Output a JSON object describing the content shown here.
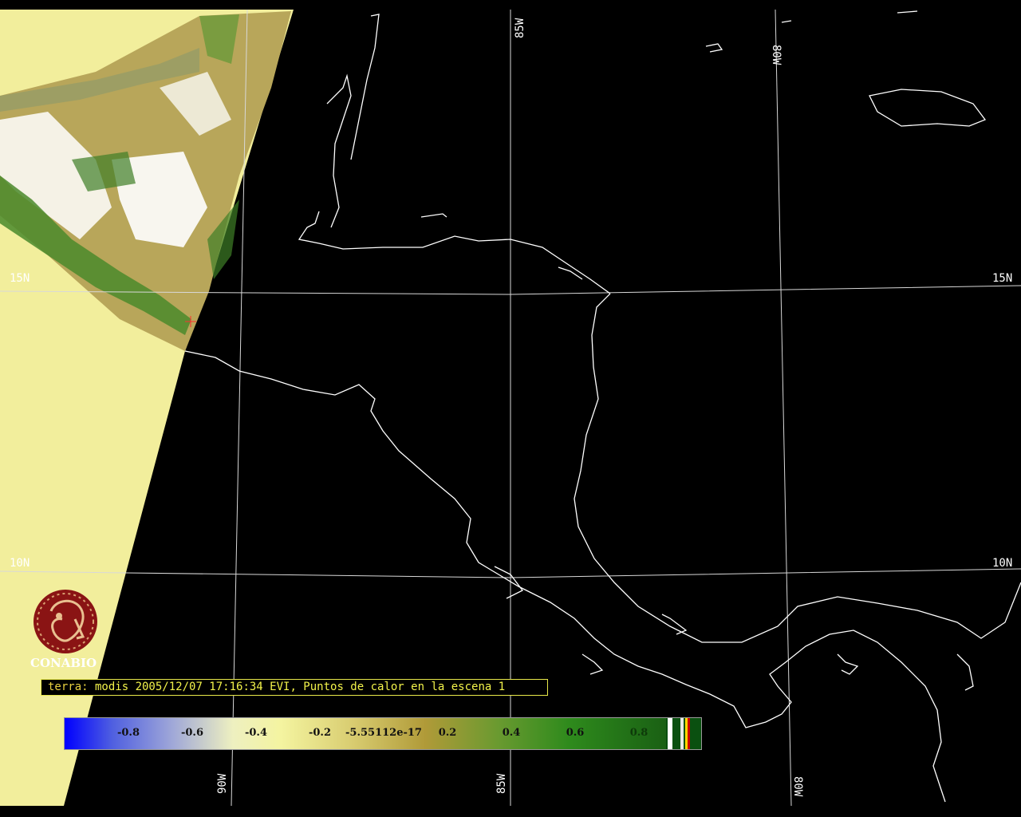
{
  "map": {
    "lat_labels": [
      "15N",
      "15N",
      "10N",
      "10N"
    ],
    "lon_labels": [
      "85W",
      "80W",
      "90W",
      "85W",
      "80W"
    ]
  },
  "caption": {
    "satellite": "terra:",
    "text": " modis 2005/12/07 17:16:34 EVI, Puntos de calor en la escena 1"
  },
  "logo": {
    "name": "CONABIO"
  },
  "colorbar": {
    "ticks": [
      "-0.8",
      "-0.6",
      "-0.4",
      "-0.2",
      "-5.55112e-17",
      "0.2",
      "0.4",
      "0.6",
      "0.8"
    ]
  },
  "colors": {
    "background": "#000000",
    "no_data": "#f2ee9c",
    "coastline": "#ffffff",
    "caption": "#f2f24a",
    "logo": "#8a1414"
  }
}
